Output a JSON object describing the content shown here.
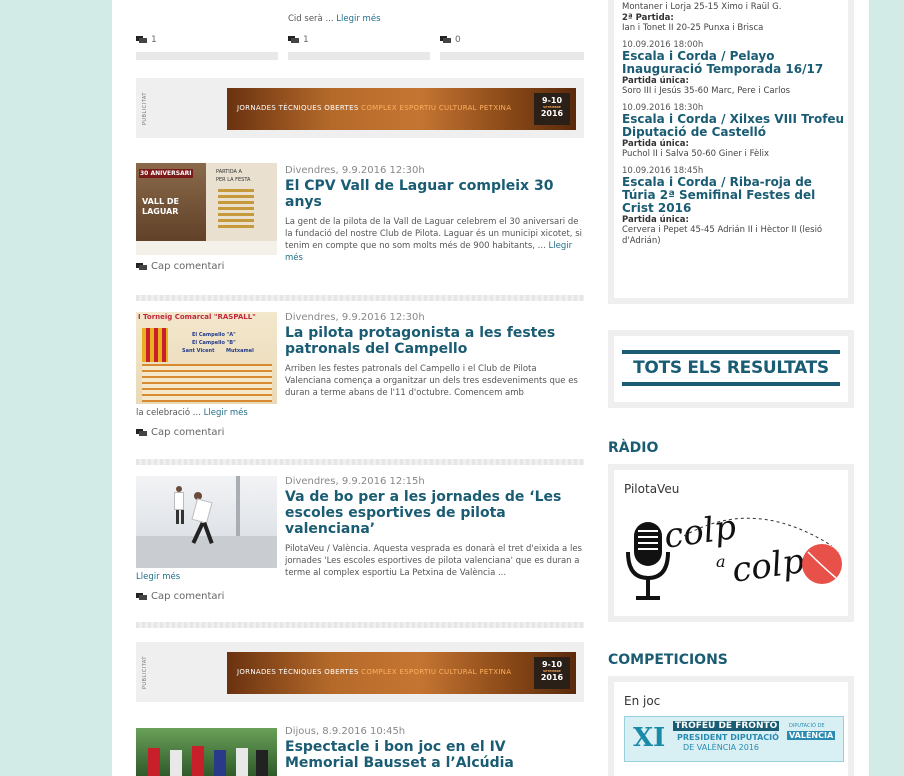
{
  "top_snippet": {
    "text": "Cid serà ...",
    "link": "Llegir més",
    "counts": [
      "1",
      "1",
      "0"
    ]
  },
  "publicitat": {
    "label": "PUBLICITAT",
    "banner_text_a": "JORNADES TÈCNIQUES OBERTES",
    "banner_text_b": "COMPLEX ESPORTIU CULTURAL PETXINA",
    "banner_date_days": "9-10",
    "banner_date_month": "SETEMBRE",
    "banner_date_year": "2016"
  },
  "articles": [
    {
      "date": "Divendres, 9.9.2016 12:30h",
      "title": "El CPV Vall de Laguar compleix 30 anys",
      "excerpt": "La gent de la pilota de la Vall de Laguar celebrem el 30 aniversari de la fundació del nostre Club de Pilota. Laguar és un municipi xicotet, si tenim en compte que no som molts més de 900 habitants, ...",
      "link": "Llegir més",
      "tail": "",
      "comments": "Cap comentari",
      "thumb": {
        "line1": "30 ANIVERSARI",
        "line2": "VALL DE",
        "line3": "LAGUAR",
        "line4": "PARTIDA A",
        "line5": "PER LA FESTA"
      }
    },
    {
      "date": "Divendres, 9.9.2016 12:30h",
      "title": "La pilota protagonista a les festes patronals del Campello",
      "excerpt": "Arriben les festes patronals del Campello i el Club de Pilota Valenciana comença a organitzar un dels tres esdeveniments que es duran a terme abans de l'11 d'octubre. Comencem amb",
      "link": "Llegir més",
      "tail": "la celebració ...",
      "comments": "Cap comentari",
      "thumb": {
        "line1": "I Torneig Comarcal \"RASPALL\"",
        "line2": "El Campello \"A\"",
        "line3": "El Campello \"B\"",
        "line4": "Sant Vicent",
        "line5": "Mutxamel"
      }
    },
    {
      "date": "Divendres, 9.9.2016 12:15h",
      "title": "Va de bo per a les jornades de ‘Les escoles esportives de pilota valenciana’",
      "excerpt": "PilotaVeu / València. Aquesta vesprada es donarà el tret d'eixida a les jornades 'Les escoles esportives de pilota valenciana' que es duran a terme al complex esportiu La Petxina de València ...",
      "link": "Llegir més",
      "tail": "",
      "comments": "Cap comentari"
    },
    {
      "date": "Dijous, 8.9.2016 10:45h",
      "title": "Espectacle i bon joc en el IV Memorial Bausset a l’Alcúdia"
    }
  ],
  "sidebar": {
    "results_top": {
      "line0": "Montaner i Lorja 25-15  Ximo i Raül G.",
      "part2_label": "2ª Partida:",
      "part2_score": "Ian i Tonet II 20-25 Punxa i Brisca"
    },
    "results": [
      {
        "date": "10.09.2016 18:00h",
        "title": "Escala i Corda / Pelayo Inauguració Temporada 16/17",
        "part": "Partida única:",
        "score": "Soro III i Jesús 35-60 Marc, Pere i Carlos"
      },
      {
        "date": "10.09.2016 18:30h",
        "title": "Escala i Corda / Xilxes VIII Trofeu Diputació de Castelló",
        "part": "Partida única:",
        "score": "Puchol II i Salva 50-60 Giner i Fèlix"
      },
      {
        "date": "10.09.2016 18:45h",
        "title": "Escala i Corda / Riba-roja de Túria 2ª Semifinal Festes del Crist 2016",
        "part": "Partida única:",
        "score": "Cervera i Pepet 45-45 Adrián II i Hèctor II (lesió d'Adrián)"
      }
    ],
    "tots_button": "TOTS ELS RESULTATS",
    "radio_title": "RÀDIO",
    "radio_box_title": "PilotaVeu",
    "radio_logo_a": "colp",
    "radio_logo_mid": "a",
    "radio_logo_b": "colp",
    "competicions_title": "COMPETICIONS",
    "en_joc": "En joc",
    "trofeu": {
      "num": "XI",
      "line1": "TROFEU DE FRONTÓ",
      "line2": "PRESIDENT DIPUTACIÓ",
      "line3": "DE VALÈNCIA 2016",
      "tag1": "DIPUTACIÓ DE",
      "tag2": "VALÈNCIA"
    }
  },
  "colors": {
    "title": "#1a5c73",
    "background": "#d3ebe7",
    "accent": "#1f6f8a"
  }
}
